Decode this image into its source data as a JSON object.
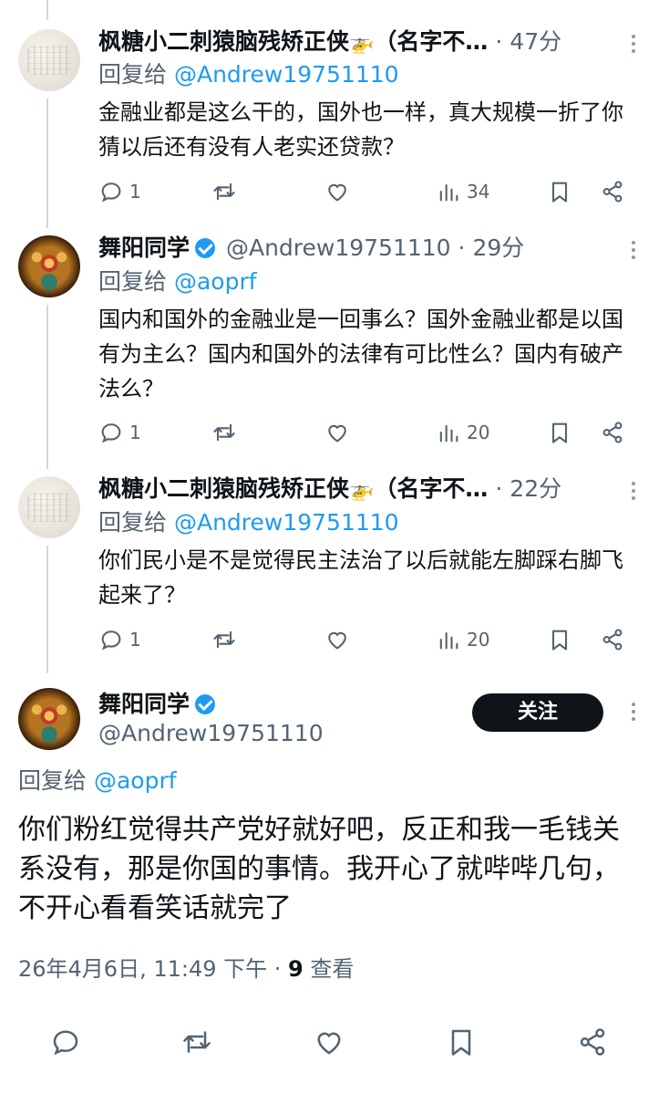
{
  "replies": [
    {
      "name": "枫糖小二刺猿脑残矫正侠",
      "emoji": "🚁",
      "name_suffix": "（名字不…",
      "time": "· 47分",
      "reply_prefix": "回复给",
      "reply_to": "@Andrew19751110",
      "body": "金融业都是这么干的，国外也一样，真大规模一折了你猜以后还有没有人老实还贷款？",
      "reply_count": "1",
      "views": "34"
    },
    {
      "name": "舞阳同学",
      "handle": "@Andrew19751110",
      "time": "· 29分",
      "reply_prefix": "回复给",
      "reply_to": "@aoprf",
      "body": "国内和国外的金融业是一回事么？国外金融业都是以国有为主么？国内和国外的法律有可比性么？国内有破产法么？",
      "reply_count": "1",
      "views": "20"
    },
    {
      "name": "枫糖小二刺猿脑残矫正侠",
      "emoji": "🚁",
      "name_suffix": "（名字不…",
      "time": "· 22分",
      "reply_prefix": "回复给",
      "reply_to": "@Andrew19751110",
      "body": "你们民小是不是觉得民主法治了以后就能左脚踩右脚飞起来了？",
      "reply_count": "1",
      "views": "20"
    }
  ],
  "main": {
    "name": "舞阳同学",
    "handle": "@Andrew19751110",
    "follow_label": "关注",
    "reply_prefix": "回复给",
    "reply_to": "@aoprf",
    "body": "你们粉红觉得共产党好就好吧，反正和我一毛钱关系没有，那是你国的事情。我开心了就哔哔几句，不开心看看笑话就完了",
    "timestamp": "26年4月6日, 11:49 下午 · ",
    "view_count": "9",
    "view_label": " 查看"
  },
  "icons": [
    "reply-icon",
    "retweet-icon",
    "like-icon",
    "views-icon",
    "bookmark-icon",
    "share-icon",
    "more-icon",
    "verified-icon"
  ],
  "colors": {
    "accent": "#1d9bf0",
    "text": "#0f1419",
    "muted": "#536471",
    "button": "#0f1419"
  }
}
